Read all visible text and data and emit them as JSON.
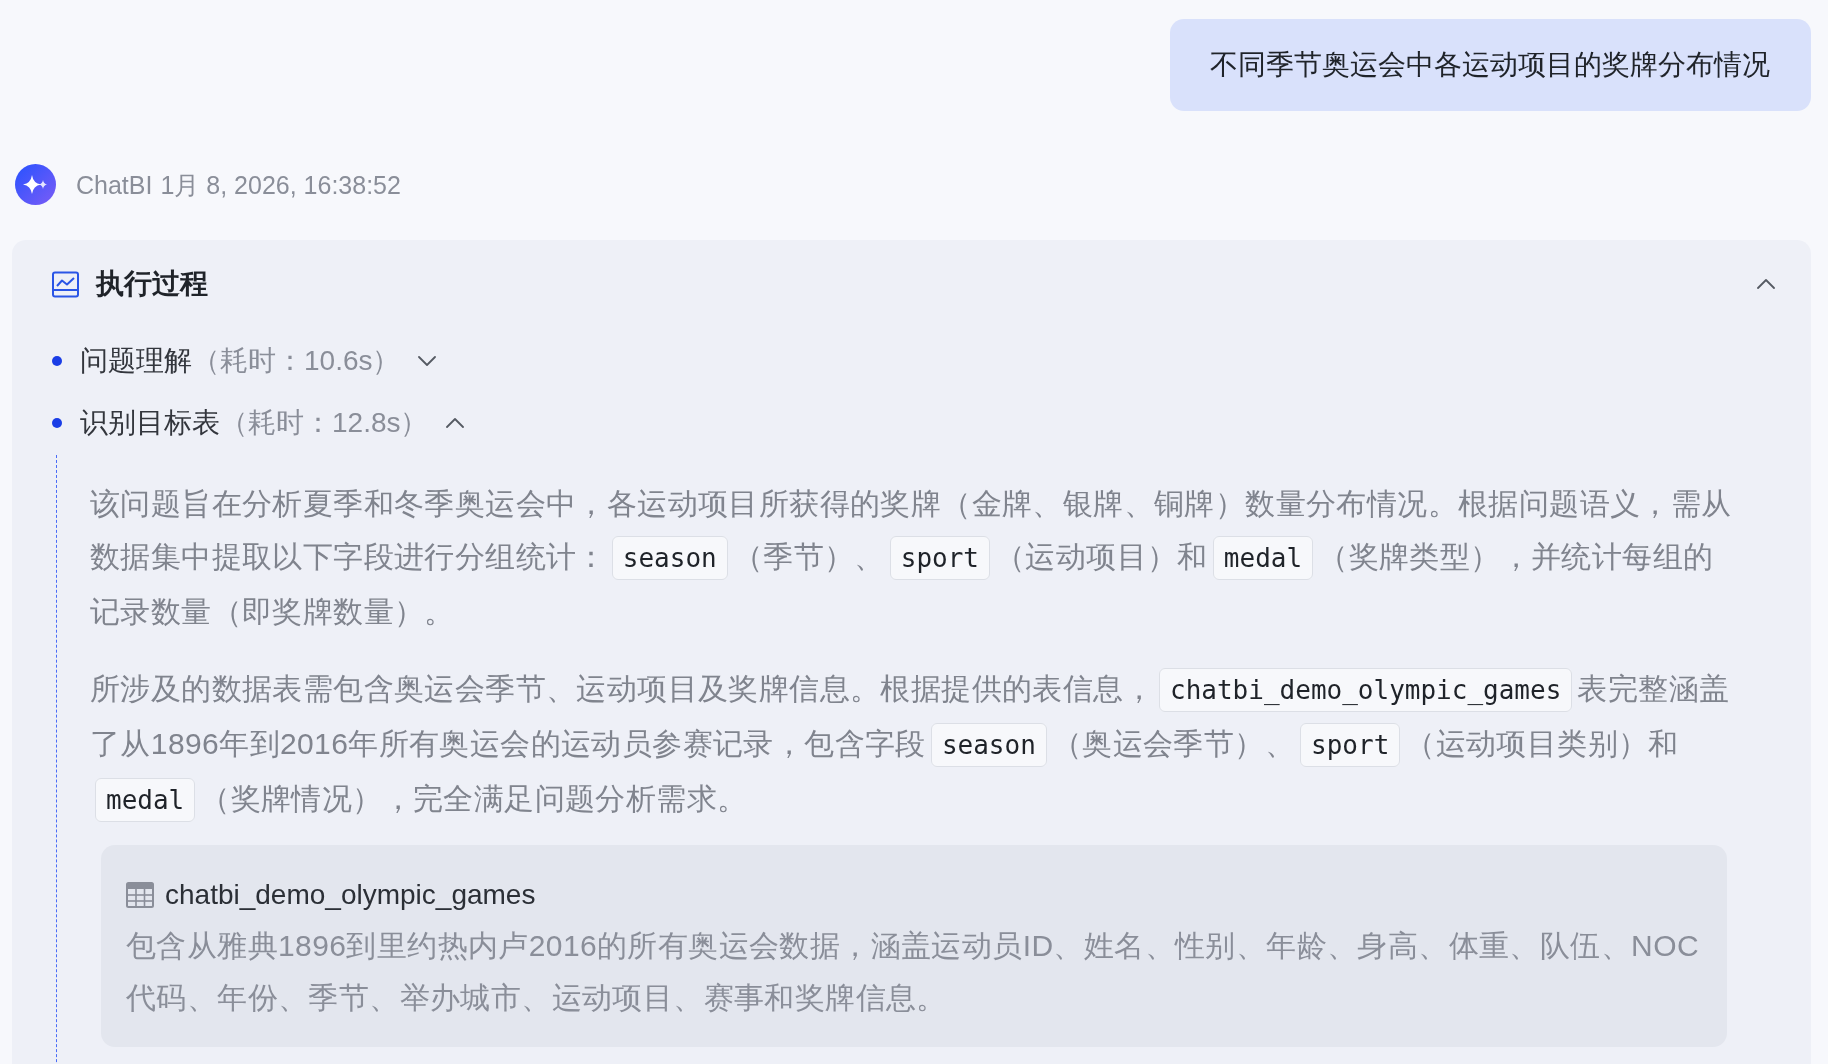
{
  "user_message": {
    "text": "不同季节奥运会中各运动项目的奖牌分布情况"
  },
  "bot_message": {
    "sender": "ChatBI",
    "timestamp": "1月 8, 2026, 16:38:52",
    "process": {
      "title": "执行过程",
      "expanded": true,
      "steps": [
        {
          "name": "问题理解",
          "duration": "（耗时：10.6s）",
          "expanded": false
        },
        {
          "name": "识别目标表",
          "duration": "（耗时：12.8s）",
          "expanded": true,
          "paragraphs": [
            [
              {
                "kind": "text",
                "text": "该问题旨在分析夏季和冬季奥运会中，各运动项目所获得的奖牌（金牌、银牌、铜牌）数量分布情况。根据问题语义，需从数据集中提取以下字段进行分组统计："
              },
              {
                "kind": "code",
                "text": "season"
              },
              {
                "kind": "text",
                "text": "（季节）、"
              },
              {
                "kind": "code",
                "text": "sport"
              },
              {
                "kind": "text",
                "text": "（运动项目）和"
              },
              {
                "kind": "code",
                "text": "medal"
              },
              {
                "kind": "text",
                "text": "（奖牌类型），并统计每组的记录数量（即奖牌数量）。"
              }
            ],
            [
              {
                "kind": "text",
                "text": "所涉及的数据表需包含奥运会季节、运动项目及奖牌信息。根据提供的表信息，"
              },
              {
                "kind": "code",
                "text": "chatbi_demo_olympic_games"
              },
              {
                "kind": "text",
                "text": "表完整涵盖了从1896年到2016年所有奥运会的运动员参赛记录，包含字段"
              },
              {
                "kind": "code",
                "text": "season"
              },
              {
                "kind": "text",
                "text": "（奥运会季节）、"
              },
              {
                "kind": "code",
                "text": "sport"
              },
              {
                "kind": "text",
                "text": "（运动项目类别）和"
              },
              {
                "kind": "code",
                "text": "medal"
              },
              {
                "kind": "text",
                "text": "（奖牌情况），完全满足问题分析需求。"
              }
            ]
          ],
          "table": {
            "name": "chatbi_demo_olympic_games",
            "description": "包含从雅典1896到里约热内卢2016的所有奥运会数据，涵盖运动员ID、姓名、性别、年龄、身高、体重、队伍、NOC代码、年份、季节、举办城市、运动项目、赛事和奖牌信息。"
          }
        }
      ]
    }
  }
}
